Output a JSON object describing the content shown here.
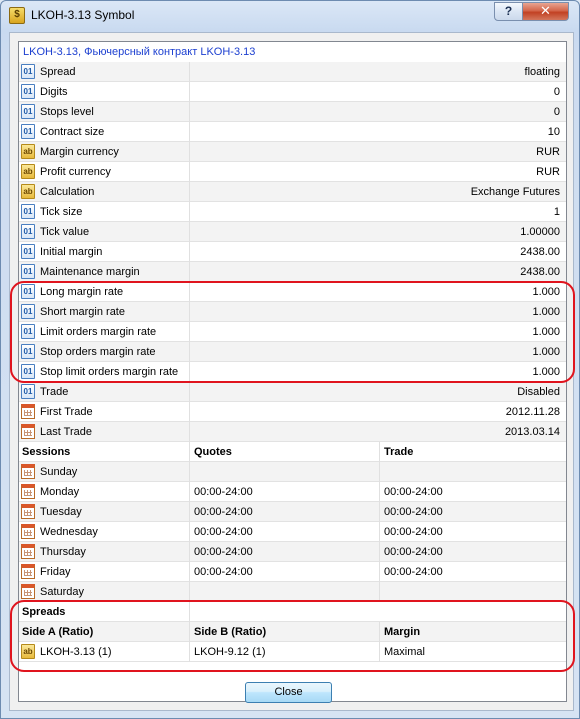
{
  "window": {
    "title": "LKOH-3.13 Symbol",
    "help_label": "?",
    "close_icon": "close-icon"
  },
  "list": {
    "header": "LKOH-3.13, Фьючерсный контракт LKOH-3.13",
    "properties": [
      {
        "icon": "numeric-icon",
        "label": "Spread",
        "value": "floating"
      },
      {
        "icon": "numeric-icon",
        "label": "Digits",
        "value": "0"
      },
      {
        "icon": "numeric-icon",
        "label": "Stops level",
        "value": "0"
      },
      {
        "icon": "numeric-icon",
        "label": "Contract size",
        "value": "10"
      },
      {
        "icon": "text-icon",
        "label": "Margin currency",
        "value": "RUR"
      },
      {
        "icon": "text-icon",
        "label": "Profit currency",
        "value": "RUR"
      },
      {
        "icon": "text-icon",
        "label": "Calculation",
        "value": "Exchange Futures"
      },
      {
        "icon": "numeric-icon",
        "label": "Tick size",
        "value": "1"
      },
      {
        "icon": "numeric-icon",
        "label": "Tick value",
        "value": "1.00000"
      },
      {
        "icon": "numeric-icon",
        "label": "Initial margin",
        "value": "2438.00"
      },
      {
        "icon": "numeric-icon",
        "label": "Maintenance margin",
        "value": "2438.00"
      },
      {
        "icon": "numeric-icon",
        "label": "Long margin rate",
        "value": "1.000"
      },
      {
        "icon": "numeric-icon",
        "label": "Short margin rate",
        "value": "1.000"
      },
      {
        "icon": "numeric-icon",
        "label": "Limit orders margin rate",
        "value": "1.000"
      },
      {
        "icon": "numeric-icon",
        "label": "Stop orders margin rate",
        "value": "1.000"
      },
      {
        "icon": "numeric-icon",
        "label": "Stop limit orders margin rate",
        "value": "1.000"
      },
      {
        "icon": "numeric-icon",
        "label": "Trade",
        "value": "Disabled"
      },
      {
        "icon": "calendar-icon",
        "label": "First Trade",
        "value": "2012.11.28"
      },
      {
        "icon": "calendar-icon",
        "label": "Last Trade",
        "value": "2013.03.14"
      }
    ],
    "sessions": {
      "headers": [
        "Sessions",
        "Quotes",
        "Trade"
      ],
      "rows": [
        {
          "day": "Sunday",
          "quotes": "",
          "trade": ""
        },
        {
          "day": "Monday",
          "quotes": "00:00-24:00",
          "trade": "00:00-24:00"
        },
        {
          "day": "Tuesday",
          "quotes": "00:00-24:00",
          "trade": "00:00-24:00"
        },
        {
          "day": "Wednesday",
          "quotes": "00:00-24:00",
          "trade": "00:00-24:00"
        },
        {
          "day": "Thursday",
          "quotes": "00:00-24:00",
          "trade": "00:00-24:00"
        },
        {
          "day": "Friday",
          "quotes": "00:00-24:00",
          "trade": "00:00-24:00"
        },
        {
          "day": "Saturday",
          "quotes": "",
          "trade": ""
        }
      ]
    },
    "spreads": {
      "title": "Spreads",
      "headers": [
        "Side A (Ratio)",
        "Side B (Ratio)",
        "Margin"
      ],
      "rows": [
        {
          "side_a": "LKOH-3.13 (1)",
          "side_b": "LKOH-9.12 (1)",
          "margin": "Maximal"
        }
      ]
    }
  },
  "close_button": "Close",
  "colors": {
    "highlight_border": "#e0141e",
    "header_text": "#1c3fd0"
  }
}
